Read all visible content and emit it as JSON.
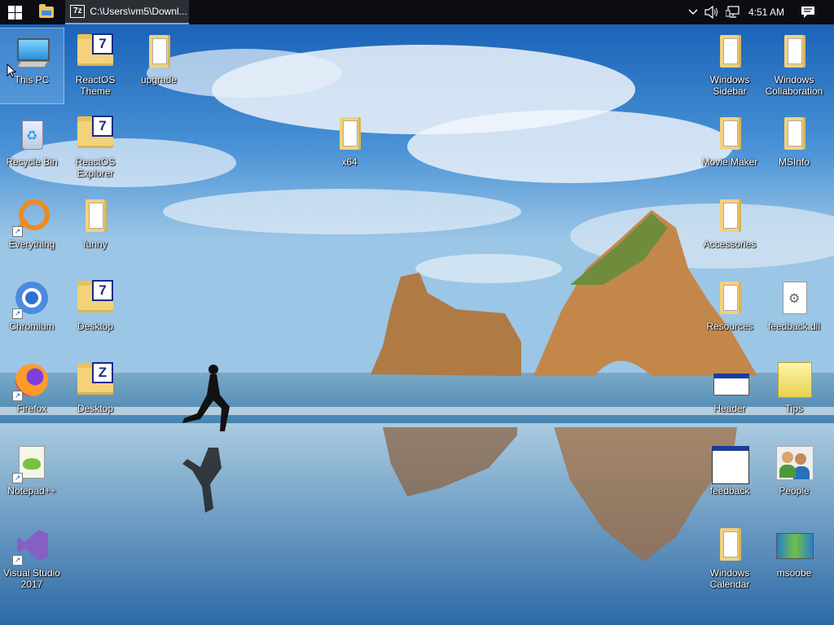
{
  "taskbar": {
    "window_title": "C:\\Users\\vm5\\Downl...",
    "window_icon_text": "7z",
    "clock": "4:51 AM",
    "icons": [
      "windows-logo-icon",
      "file-explorer-icon",
      "chevron-up-icon",
      "volume-icon",
      "network-icon",
      "notification-icon"
    ]
  },
  "desktop": {
    "icons": {
      "this_pc": "This PC",
      "reactos_theme": "ReactOS Theme",
      "upgrade": "upgrade",
      "recycle_bin": "Recycle Bin",
      "reactos_explorer": "ReactOS Explorer",
      "x64": "x64",
      "everything": "Everything",
      "funny": "funny",
      "chromium": "Chromium",
      "desktop_7": "Desktop",
      "firefox": "Firefox",
      "desktop_z": "Desktop",
      "notepadpp": "Notepad++",
      "visual_studio": "Visual Studio 2017",
      "windows_sidebar": "Windows Sidebar",
      "windows_collaboration": "Windows Collaboration",
      "movie_maker": "Movie Maker",
      "msinfo": "MSInfo",
      "accessories": "Accessories",
      "resources": "Resources",
      "feedback_dll": "feedback.dll",
      "header": "Header",
      "tips": "Tips",
      "feedback": "feedback",
      "people": "People",
      "windows_calendar": "Windows Calendar",
      "msoobe": "msoobe"
    },
    "badges": {
      "seven": "7",
      "z": "Z"
    }
  },
  "colors": {
    "taskbar": "#0b0d12",
    "sky_top": "#1f6fc4",
    "folder": "#f3d27a",
    "selection": "#99d1ff"
  }
}
